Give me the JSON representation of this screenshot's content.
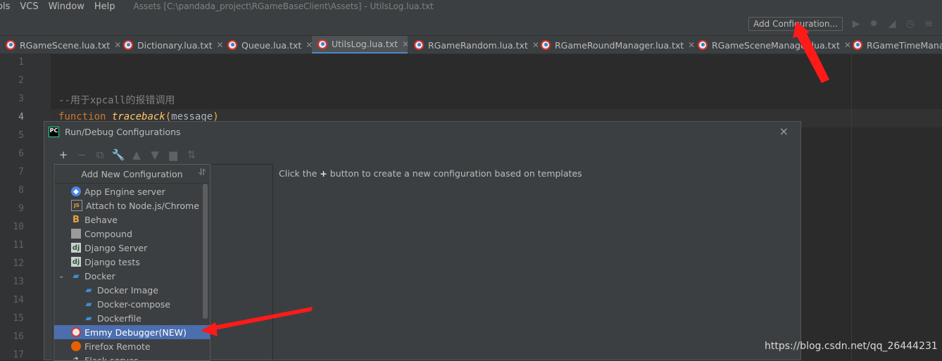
{
  "menubar": {
    "items": [
      "ols",
      "VCS",
      "Window",
      "Help"
    ],
    "window_title": "Assets [C:\\pandada_project\\RGameBaseClient\\Assets] - UtilsLog.lua.txt"
  },
  "toolbar": {
    "add_configuration": "Add Configuration...",
    "icons": [
      "run-icon",
      "debug-icon",
      "coverage-icon",
      "profile-icon",
      "stop-icon"
    ]
  },
  "tabs": [
    {
      "label": "RGameScene.lua.txt",
      "active": false
    },
    {
      "label": "Dictionary.lua.txt",
      "active": false
    },
    {
      "label": "Queue.lua.txt",
      "active": false
    },
    {
      "label": "UtilsLog.lua.txt",
      "active": true
    },
    {
      "label": "RGameRandom.lua.txt",
      "active": false
    },
    {
      "label": "RGameRoundManager.lua.txt",
      "active": false
    },
    {
      "label": "RGameSceneManager.lua.txt",
      "active": false
    },
    {
      "label": "RGameTimeManag",
      "active": false
    }
  ],
  "editor": {
    "line_numbers": [
      "1",
      "2",
      "3",
      "4",
      "5",
      "6",
      "7",
      "8",
      "9",
      "10",
      "11",
      "12",
      "13",
      "14",
      "15",
      "16",
      "17"
    ],
    "current_line": "4",
    "line3_comment": "--用于xpcall的报错调用",
    "line4_keyword": "function",
    "line4_name": "traceback",
    "line4_paren_open": "(",
    "line4_param": "message",
    "line4_paren_close": ")"
  },
  "dialog": {
    "title": "Run/Debug Configurations",
    "close": "×",
    "hint_before": "Click the",
    "hint_plus": "+",
    "hint_after": "button to create a new configuration based on templates",
    "popup": {
      "header": "Add New Configuration",
      "items": [
        {
          "label": "App Engine server",
          "icon": "app-engine-icon",
          "indent": false
        },
        {
          "label": "Attach to Node.js/Chrome",
          "icon": "nodejs-icon",
          "indent": false
        },
        {
          "label": "Behave",
          "icon": "behave-icon",
          "indent": false
        },
        {
          "label": "Compound",
          "icon": "compound-icon",
          "indent": false
        },
        {
          "label": "Django Server",
          "icon": "django-icon",
          "indent": false
        },
        {
          "label": "Django tests",
          "icon": "django-tests-icon",
          "indent": false
        },
        {
          "label": "Docker",
          "icon": "docker-icon",
          "indent": false,
          "expanded": true
        },
        {
          "label": "Docker Image",
          "icon": "docker-icon",
          "indent": true
        },
        {
          "label": "Docker-compose",
          "icon": "docker-icon",
          "indent": true
        },
        {
          "label": "Dockerfile",
          "icon": "docker-icon",
          "indent": true
        },
        {
          "label": "Emmy Debugger(NEW)",
          "icon": "emmy-icon",
          "indent": false,
          "selected": true
        },
        {
          "label": "Firefox Remote",
          "icon": "firefox-icon",
          "indent": false
        },
        {
          "label": "Flask server",
          "icon": "flask-icon",
          "indent": false
        }
      ]
    }
  },
  "watermark": "https://blog.csdn.net/qq_26444231",
  "colors": {
    "accent": "#4a88c7",
    "selection": "#4b6eaf",
    "arrow": "#ff1a1a"
  }
}
